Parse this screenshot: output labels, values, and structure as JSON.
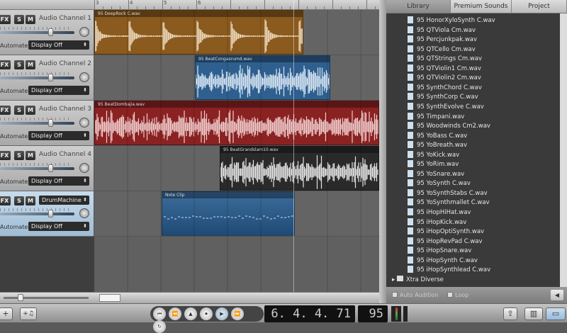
{
  "tracks": [
    {
      "fx": "FX",
      "solo": "S",
      "mute": "M",
      "name": "Audio Channel 1",
      "automate_label": "Automate:",
      "automate": "Display Off",
      "clip": "95 DeepRock C.wav",
      "color": "#8a5a1e",
      "wave": "#eedcc0",
      "selected": false
    },
    {
      "fx": "FX",
      "solo": "S",
      "mute": "M",
      "name": "Audio Channel 2",
      "automate_label": "Automate:",
      "automate": "Display Off",
      "clip": "95 BeatCongasrumd.wav",
      "color": "#2e5f8e",
      "wave": "#d8e6f4",
      "selected": false
    },
    {
      "fx": "FX",
      "solo": "S",
      "mute": "M",
      "name": "Audio Channel 3",
      "automate_label": "Automate:",
      "automate": "Display Off",
      "clip": "95 BeatDombajia.wav",
      "color": "#8a2222",
      "wave": "#f0cccc",
      "selected": false
    },
    {
      "fx": "FX",
      "solo": "S",
      "mute": "M",
      "name": "Audio Channel 4",
      "automate_label": "Automate:",
      "automate": "Display Off",
      "clip": "95 BeatGrandslam10.wav",
      "color": "#2a2a2a",
      "wave": "#e4e4e4",
      "selected": false
    },
    {
      "fx": "FX",
      "solo": "S",
      "mute": "M",
      "name": "DrumMachine",
      "automate_label": "Automate:",
      "automate": "Display Off",
      "clip": "Note Clip",
      "color": "#2d5a8a",
      "wave": "#cfe0f0",
      "selected": true
    }
  ],
  "ruler": {
    "labels": [
      "3",
      "4",
      "5",
      "6"
    ]
  },
  "browser": {
    "tabs": [
      "Library",
      "Premium Sounds",
      "Project"
    ],
    "active_tab": "Library",
    "items": [
      "95 HonorXyloSynth C.wav",
      "95 QTViola Cm.wav",
      "95 Percjunkpak.wav",
      "95 QTCello Cm.wav",
      "95 QTStrings Cm.wav",
      "95 QTViolin1 Cm.wav",
      "95 QTViolin2 Cm.wav",
      "95 SynthChord C.wav",
      "95 SynthCorp C.wav",
      "95 SynthEvolve C.wav",
      "95 Timpani.wav",
      "95 Woodwinds Cm2.wav",
      "95 YoBass C.wav",
      "95 YoBreath.wav",
      "95 YoKick.wav",
      "95 YoRim.wav",
      "95 YoSnare.wav",
      "95 YoSynth C.wav",
      "95 YoSynthStabs C.wav",
      "95 YoSynthmallet C.wav",
      "95 iHopHiHat.wav",
      "95 iHopKick.wav",
      "95 iHopOptiSynth.wav",
      "95 iHopRevPad C.wav",
      "95 iHopSnare.wav",
      "95 iHopSynth C.wav",
      "95 iHopSynthlead C.wav"
    ],
    "folder": "Xtra Diverse",
    "auto_audition": "Auto Audition",
    "loop": "Loop"
  },
  "toolbar": {
    "add_track": "+",
    "add_instrument": "+♫",
    "position": "6. 4. 4. 71",
    "tempo": "95",
    "transport": [
      "⏮",
      "⏪",
      "metronome",
      "⏺",
      "▶",
      "⏩",
      "loop"
    ]
  }
}
